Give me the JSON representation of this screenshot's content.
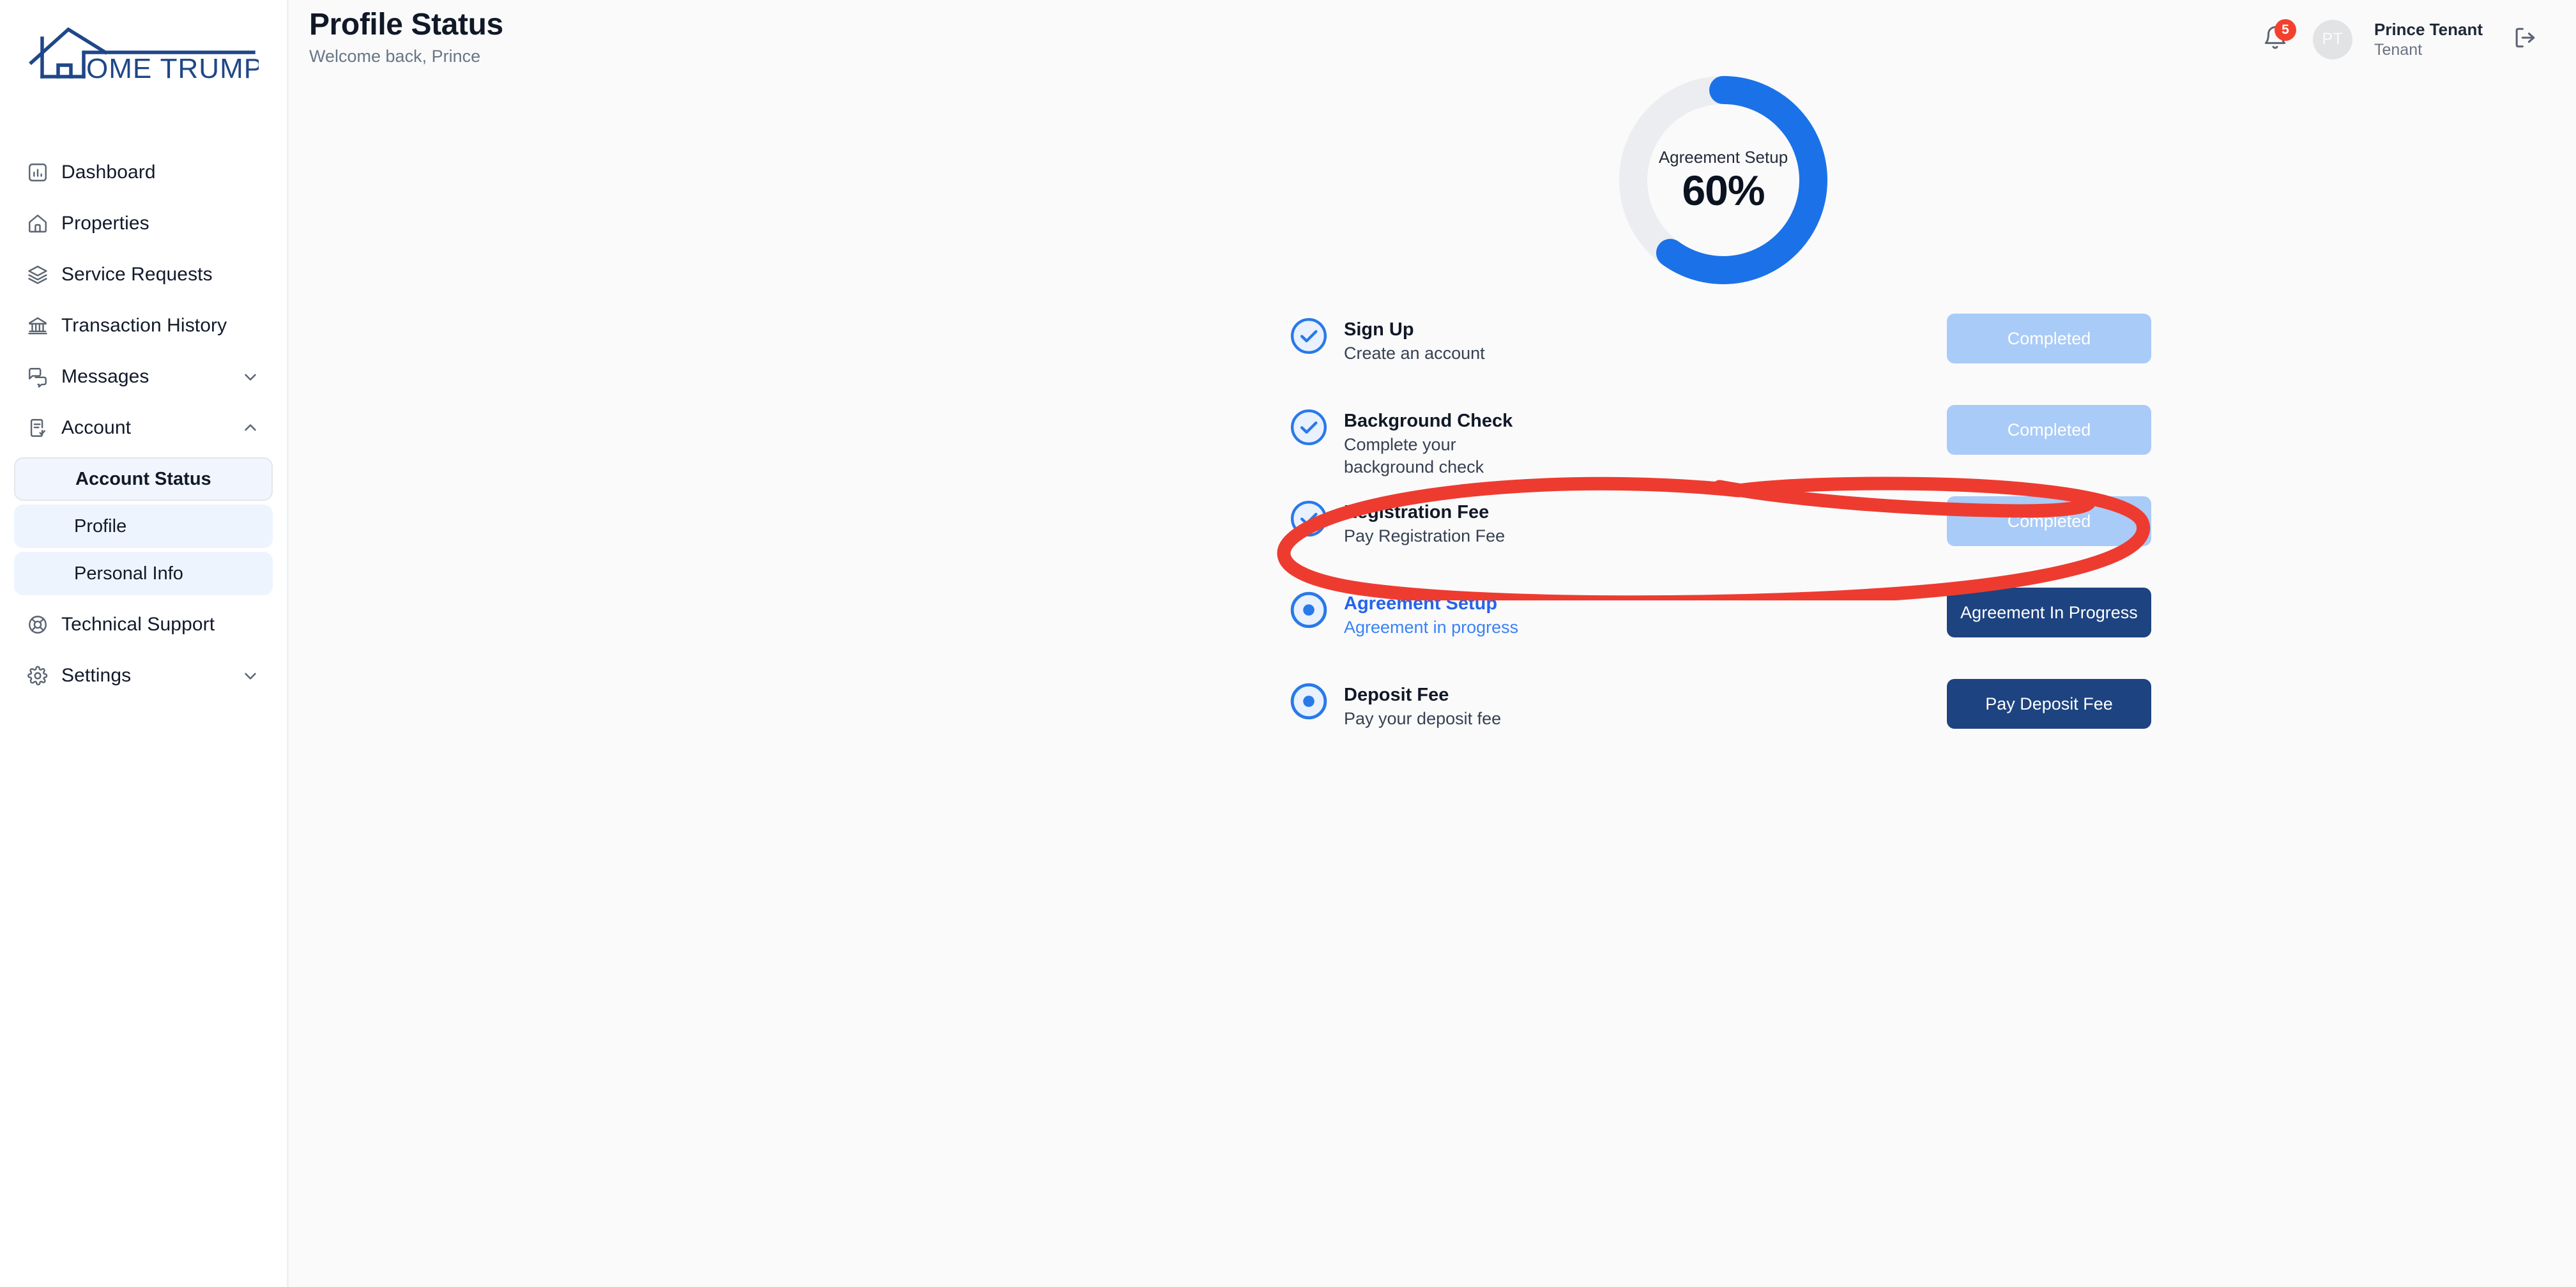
{
  "brand": {
    "name": "HOME TRUMPETER",
    "logo_text": "OME TRUMPETER",
    "color": "#1f4788"
  },
  "sidebar": {
    "items": [
      {
        "label": "Dashboard",
        "icon": "chart-bar-icon"
      },
      {
        "label": "Properties",
        "icon": "home-icon"
      },
      {
        "label": "Service Requests",
        "icon": "layers-icon"
      },
      {
        "label": "Transaction History",
        "icon": "bank-icon"
      },
      {
        "label": "Messages",
        "icon": "messages-icon",
        "chevron": "chevron-down"
      },
      {
        "label": "Account",
        "icon": "clipboard-check-icon",
        "chevron": "chevron-up"
      }
    ],
    "account_subitems": [
      {
        "label": "Account Status",
        "active": true
      },
      {
        "label": "Profile",
        "active": false
      },
      {
        "label": "Personal Info",
        "active": false
      }
    ],
    "bottom_items": [
      {
        "label": "Technical Support",
        "icon": "lifebuoy-icon"
      },
      {
        "label": "Settings",
        "icon": "gear-icon",
        "chevron": "chevron-down"
      }
    ]
  },
  "header": {
    "title": "Profile Status",
    "subtitle": "Welcome back, Prince",
    "notifications": {
      "count": "5",
      "icon": "bell-icon"
    },
    "user": {
      "initials": "PT",
      "name": "Prince Tenant",
      "role": "Tenant"
    },
    "logout_icon": "logout-icon"
  },
  "progress": {
    "label": "Agreement Setup",
    "value_text": "60%",
    "percent": 60,
    "track_color": "#ebedf0",
    "arc_color": "#1b72e8"
  },
  "steps": [
    {
      "title": "Sign Up",
      "description": "Create an account",
      "icon": "check-circle-icon",
      "state": "completed",
      "action": {
        "label": "Completed",
        "style": "completed"
      }
    },
    {
      "title": "Background Check",
      "description": "Complete your background check",
      "icon": "check-circle-icon",
      "state": "completed",
      "action": {
        "label": "Completed",
        "style": "completed"
      }
    },
    {
      "title": "Registration Fee",
      "description": "Pay Registration Fee",
      "icon": "check-circle-icon",
      "state": "completed",
      "action": {
        "label": "Completed",
        "style": "completed"
      }
    },
    {
      "title": "Agreement Setup",
      "description": "Agreement in progress",
      "icon": "dot-circle-icon",
      "state": "active",
      "action": {
        "label": "Agreement In Progress",
        "style": "primary"
      }
    },
    {
      "title": "Deposit Fee",
      "description": "Pay your deposit fee",
      "icon": "dot-circle-icon",
      "state": "pending",
      "action": {
        "label": "Pay Deposit Fee",
        "style": "primary"
      }
    }
  ],
  "annotation": {
    "shape": "hand-drawn-ellipse",
    "color": "#ee3b30",
    "targets_step_index": 2
  }
}
